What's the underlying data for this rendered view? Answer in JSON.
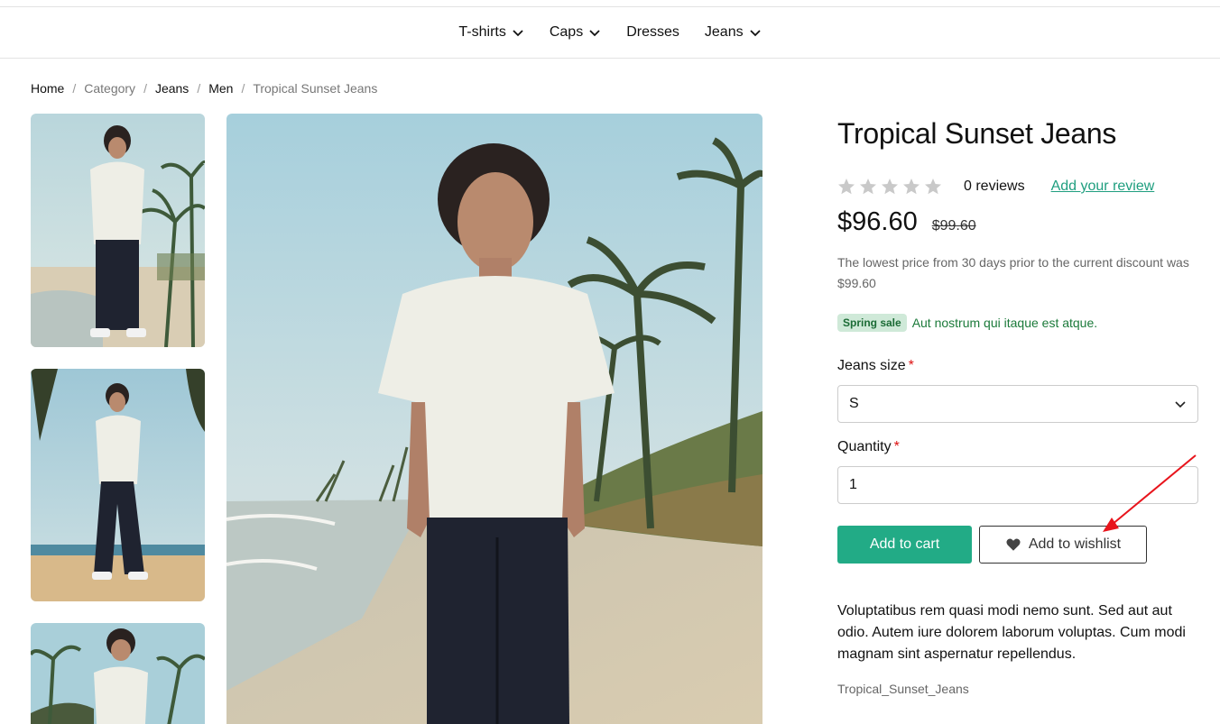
{
  "nav": {
    "items": [
      {
        "label": "T-shirts",
        "has_dropdown": true
      },
      {
        "label": "Caps",
        "has_dropdown": true
      },
      {
        "label": "Dresses",
        "has_dropdown": false
      },
      {
        "label": "Jeans",
        "has_dropdown": true
      }
    ]
  },
  "breadcrumb": {
    "home": "Home",
    "category": "Category",
    "jeans": "Jeans",
    "men": "Men",
    "current": "Tropical Sunset Jeans",
    "separator": "/"
  },
  "product": {
    "title": "Tropical Sunset Jeans",
    "rating_stars": 0,
    "reviews": "0 reviews",
    "add_review": "Add your review",
    "price": "$96.60",
    "old_price": "$99.60",
    "lowest_price_note": "The lowest price from 30 days prior to the current discount was $99.60",
    "sale_badge": "Spring sale",
    "sale_text": "Aut nostrum qui itaque est atque.",
    "size_label": "Jeans size",
    "size_value": "S",
    "quantity_label": "Quantity",
    "quantity_value": "1",
    "required_mark": "*",
    "add_to_cart": "Add to cart",
    "add_to_wishlist": "Add to wishlist",
    "description": "Voluptatibus rem quasi modi nemo sunt. Sed aut aut odio. Autem iure dolorem laborum voluptas. Cum modi magnam sint aspernatur repellendus.",
    "sku": "Tropical_Sunset_Jeans"
  },
  "colors": {
    "accent": "#22ab86",
    "link": "#1f9e7f",
    "sale_badge_bg": "#cfe9d8",
    "sale_text": "#1b7a3a",
    "required": "#dd1111",
    "annotation_arrow": "#e8141c"
  },
  "icons": {
    "nav_dropdown": "chevron-down-icon",
    "select_dropdown": "chevron-down-icon",
    "wishlist": "heart-icon",
    "rating": "star-icon"
  }
}
